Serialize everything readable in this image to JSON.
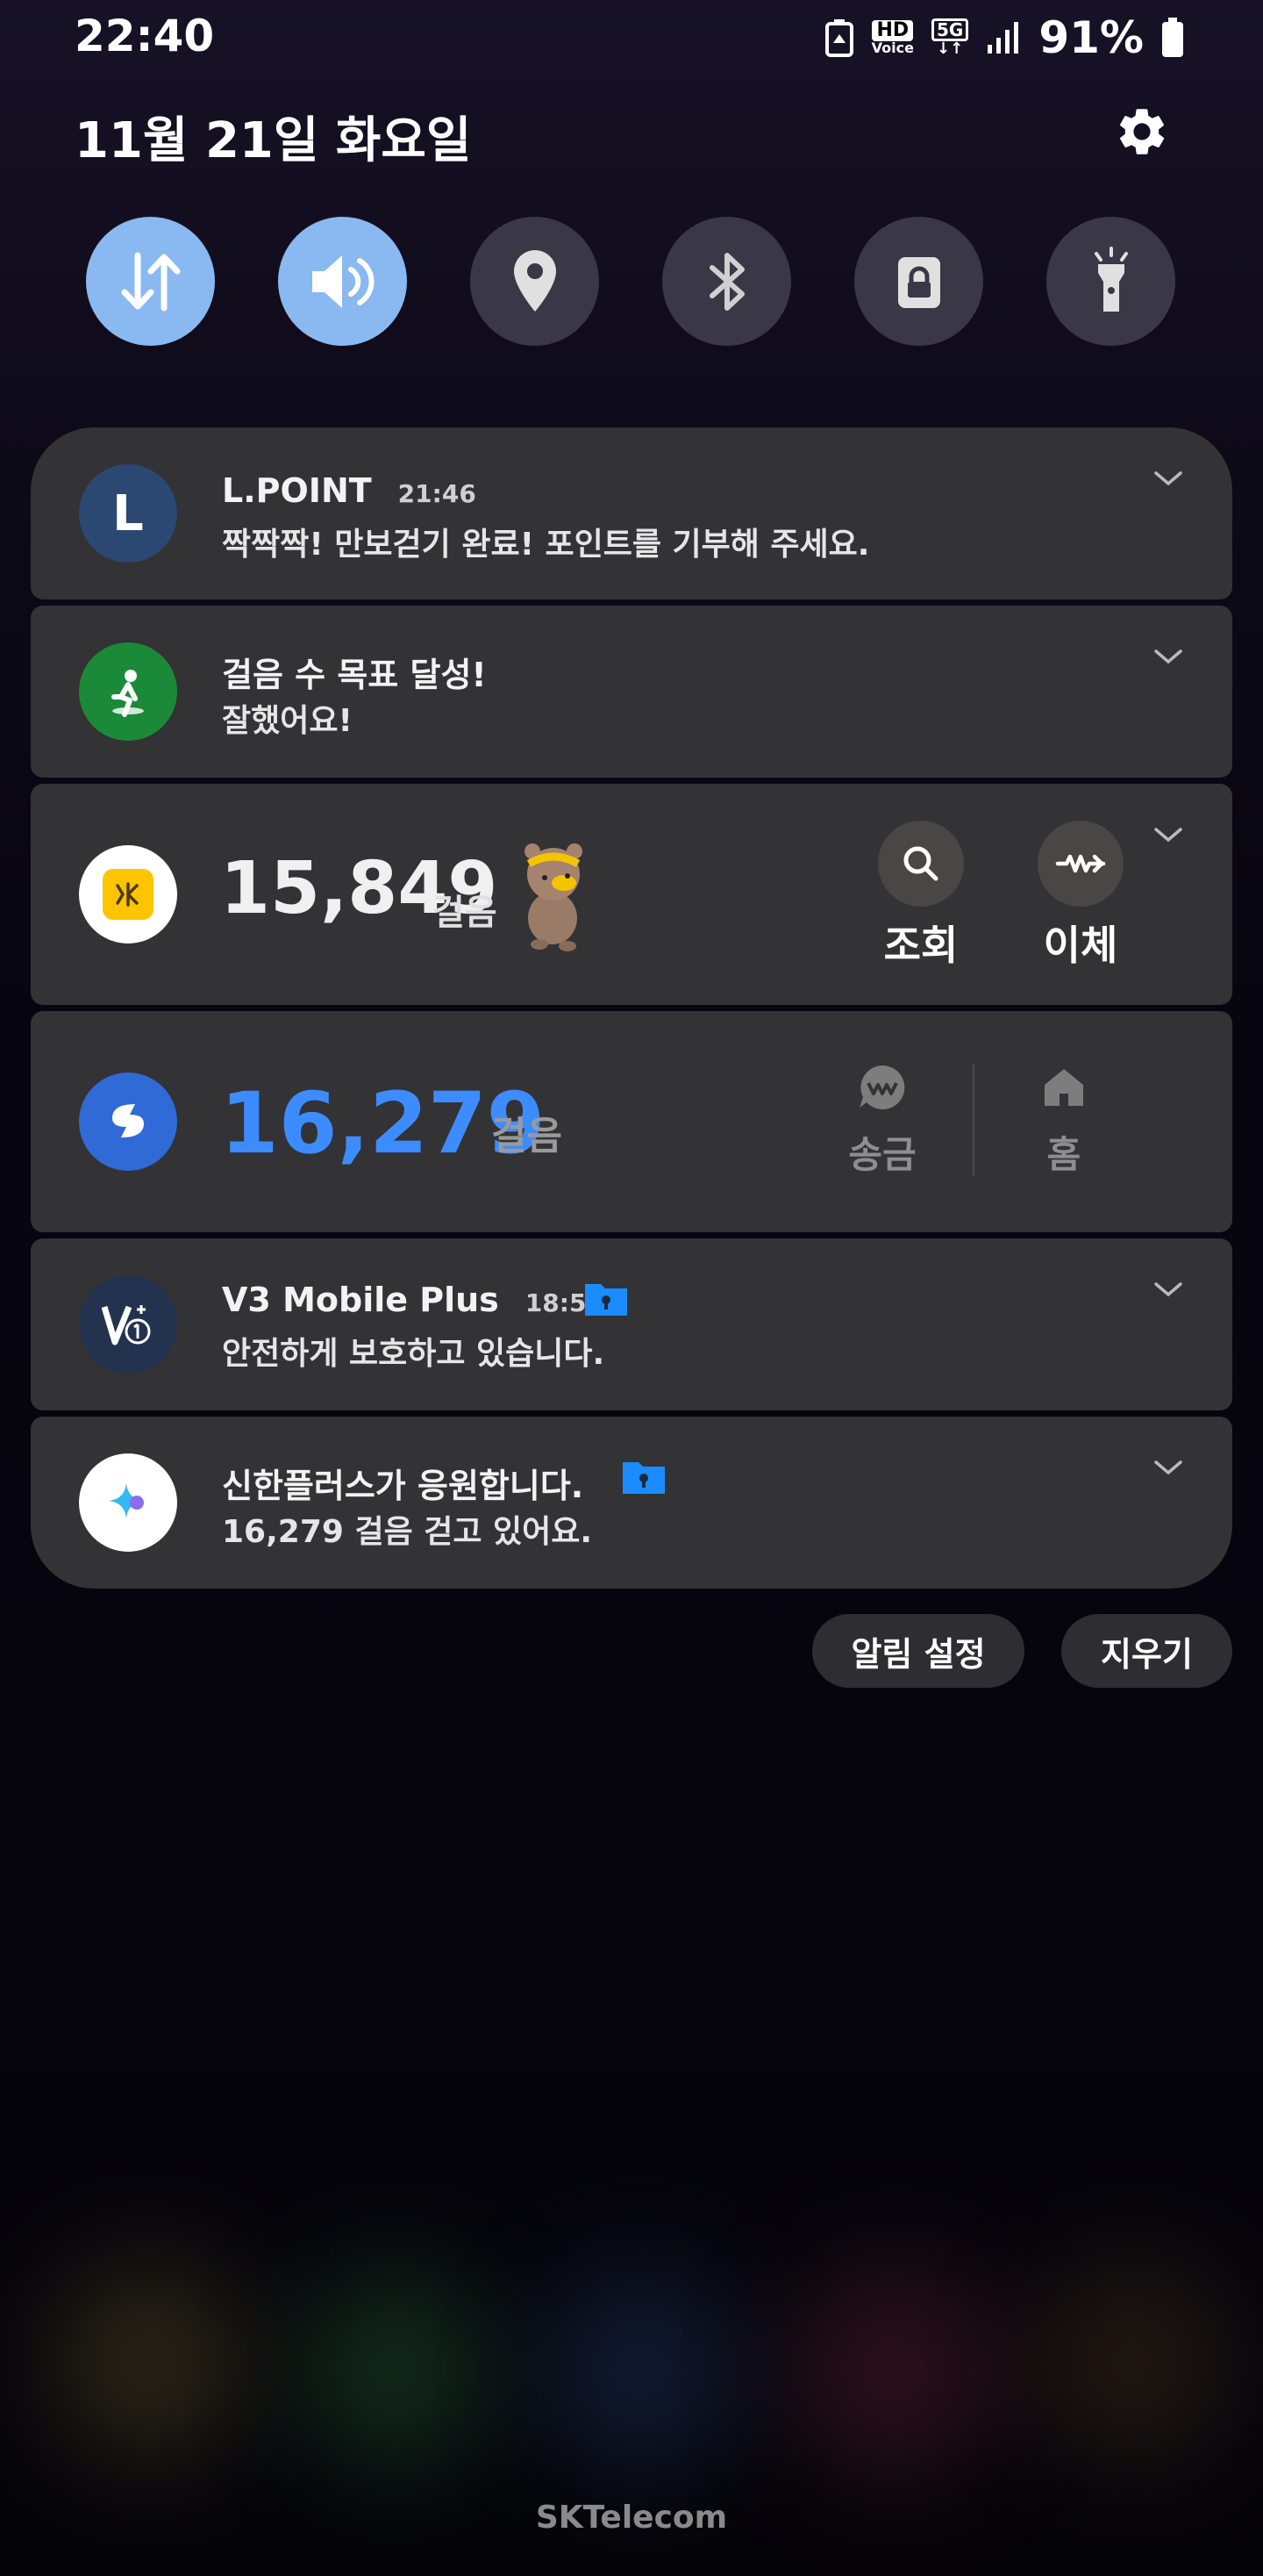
{
  "status_bar": {
    "time": "22:40",
    "hd_label": "HD",
    "voice_label": "Voice",
    "network_label": "5G",
    "battery": "91%"
  },
  "header": {
    "date": "11월 21일 화요일"
  },
  "quick_settings": [
    {
      "name": "mobile-data",
      "icon": "data-arrows-icon",
      "active": true
    },
    {
      "name": "sound",
      "icon": "speaker-icon",
      "active": true
    },
    {
      "name": "location",
      "icon": "location-pin-icon",
      "active": false
    },
    {
      "name": "bluetooth",
      "icon": "bluetooth-icon",
      "active": false
    },
    {
      "name": "rotation-lock",
      "icon": "lock-icon",
      "active": false
    },
    {
      "name": "flashlight",
      "icon": "flashlight-icon",
      "active": false
    }
  ],
  "notifications": {
    "lpoint": {
      "app": "L.POINT",
      "time": "21:46",
      "message": "짝짝짝! 만보걷기 완료! 포인트를 기부해 주세요.",
      "avatar_letter": "L"
    },
    "steps_goal": {
      "title": "걸음 수 목표 달성!",
      "message": "잘했어요!"
    },
    "kb": {
      "steps": "15,849",
      "unit": "걸음",
      "action_search": "조회",
      "action_transfer": "이체"
    },
    "shinhan_steps": {
      "steps": "16,279",
      "unit": "걸음",
      "action_send": "송금",
      "action_home": "홈"
    },
    "v3": {
      "app": "V3 Mobile Plus",
      "time": "18:57",
      "message": "안전하게 보호하고 있습니다."
    },
    "shinhan_plus": {
      "title": "신한플러스가 응원합니다.",
      "message": "16,279 걸음 걷고 있어요."
    }
  },
  "footer_actions": {
    "notification_settings": "알림 설정",
    "clear": "지우기"
  },
  "carrier": "SKTelecom",
  "colors": {
    "accent_blue": "#8ab8f0",
    "steps_blue": "#3d8cff",
    "card_bg": "#333235"
  }
}
